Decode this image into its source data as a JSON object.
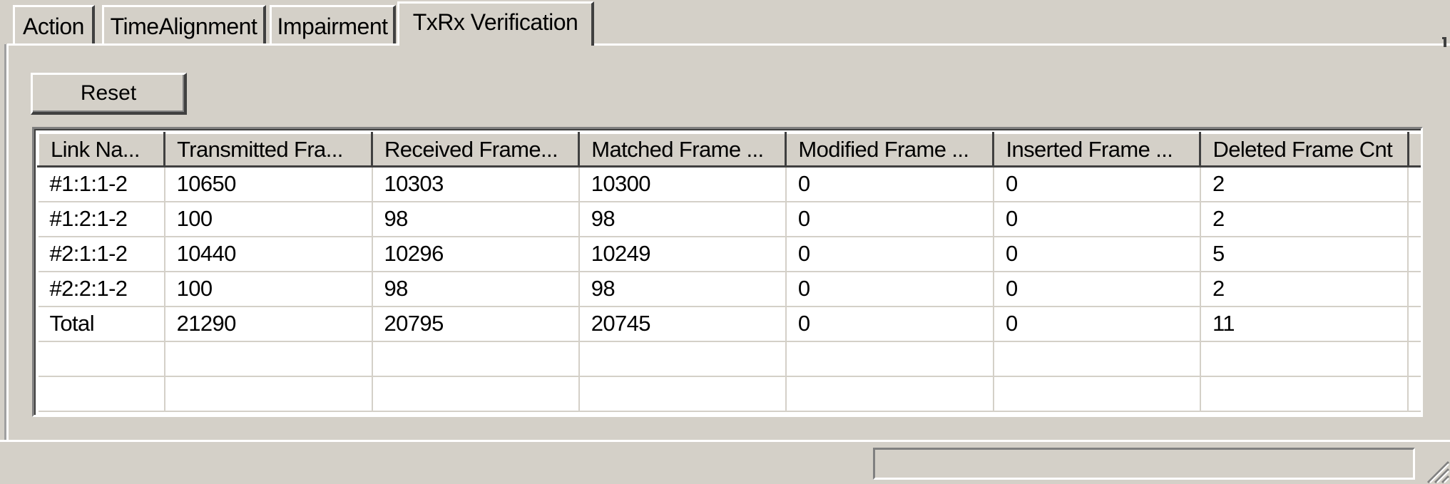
{
  "tabs": [
    {
      "label": "Action",
      "active": false
    },
    {
      "label": "TimeAlignment",
      "active": false
    },
    {
      "label": "Impairment",
      "active": false
    },
    {
      "label": "TxRx Verification",
      "active": true
    }
  ],
  "toolbar": {
    "reset_label": "Reset"
  },
  "table": {
    "columns": [
      "Link Na...",
      "Transmitted Fra...",
      "Received Frame...",
      "Matched Frame ...",
      "Modified Frame ...",
      "Inserted Frame ...",
      "Deleted Frame Cnt"
    ],
    "rows": [
      [
        "#1:1:1-2",
        "10650",
        "10303",
        "10300",
        "0",
        "0",
        "2"
      ],
      [
        "#1:2:1-2",
        "100",
        "98",
        "98",
        "0",
        "0",
        "2"
      ],
      [
        "#2:1:1-2",
        "10440",
        "10296",
        "10249",
        "0",
        "0",
        "5"
      ],
      [
        "#2:2:1-2",
        "100",
        "98",
        "98",
        "0",
        "0",
        "2"
      ],
      [
        "Total",
        "21290",
        "20795",
        "20745",
        "0",
        "0",
        "11"
      ],
      [
        "",
        "",
        "",
        "",
        "",
        "",
        ""
      ],
      [
        "",
        "",
        "",
        "",
        "",
        "",
        ""
      ]
    ]
  },
  "statusbar": {
    "text": ""
  },
  "colors": {
    "face": "#d4d0c8",
    "highlight": "#ffffff",
    "shadow": "#808080",
    "dark_shadow": "#404040"
  }
}
